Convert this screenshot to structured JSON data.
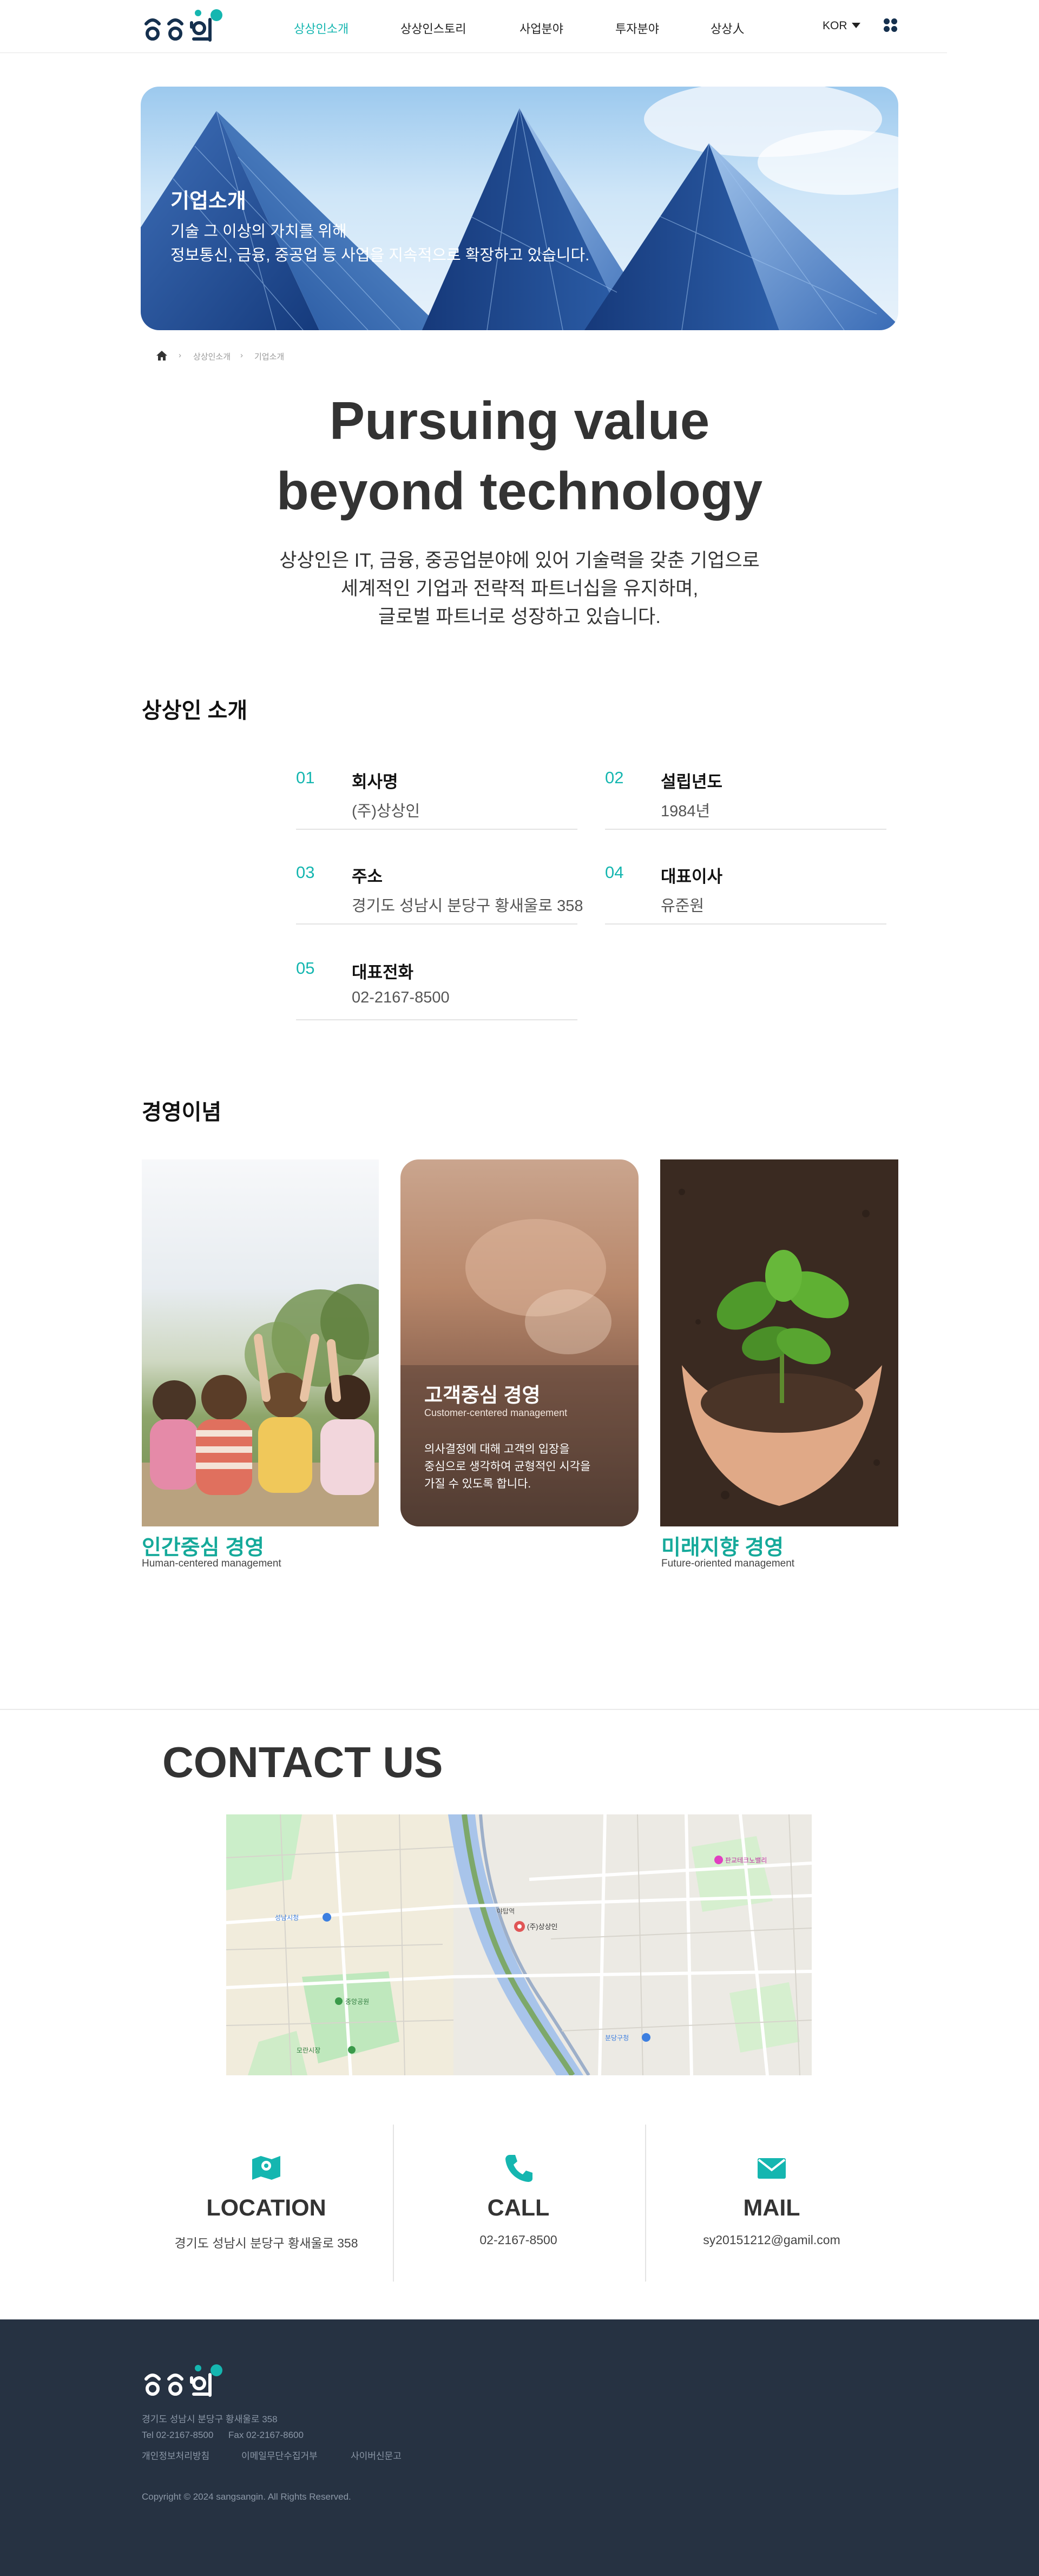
{
  "header": {
    "logo_alt": "상상인",
    "nav": [
      "상상인소개",
      "상상인스토리",
      "사업분야",
      "투자분야",
      "상상人"
    ],
    "active_index": 0,
    "lang": "KOR"
  },
  "hero": {
    "title": "기업소개",
    "subtitle_line1": "기술 그 이상의 가치를 위해",
    "subtitle_line2": "정보통신, 금융, 중공업 등 사업을 지속적으로 확장하고 있습니다."
  },
  "breadcrumb": {
    "home_icon": "home-icon",
    "items": [
      "상상인소개",
      "기업소개"
    ]
  },
  "headline": {
    "line1": "Pursuing value",
    "line2": "beyond technology"
  },
  "intro": {
    "line1": "상상인은 IT, 금융, 중공업분야에 있어 기술력을 갖춘 기업으로",
    "line2": "세계적인 기업과 전략적 파트너십을 유지하며,",
    "line3": "글로벌 파트너로 성장하고 있습니다."
  },
  "about": {
    "title": "상상인 소개",
    "items": [
      {
        "num": "01",
        "label": "회사명",
        "value": "(주)상상인"
      },
      {
        "num": "02",
        "label": "설립년도",
        "value": "1984년"
      },
      {
        "num": "03",
        "label": "주소",
        "value": "경기도 성남시 분당구 황새울로 358"
      },
      {
        "num": "04",
        "label": "대표이사",
        "value": "유준원"
      },
      {
        "num": "05",
        "label": "대표전화",
        "value": "02-2167-8500"
      }
    ]
  },
  "philosophy": {
    "title": "경영이념",
    "cards": [
      {
        "title": "인간중심 경영",
        "subtitle": "Human-centered management"
      },
      {
        "title": "고객중심 경영",
        "subtitle": "Customer-centered management",
        "desc_line1": "의사결정에 대해 고객의 입장을",
        "desc_line2": "중심으로 생각하여 균형적인 시각을",
        "desc_line3": "가질 수 있도록 합니다."
      },
      {
        "title": "미래지향 경영",
        "subtitle": "Future-oriented management"
      }
    ]
  },
  "contact": {
    "title": "CONTACT US",
    "map_labels": {
      "marker": "(주)상상인",
      "place1": "성남시청",
      "place2": "모란시장",
      "place3": "야탑역",
      "place4": "분당구청",
      "place5": "판교테크노밸리",
      "park": "중앙공원"
    },
    "items": [
      {
        "title": "LOCATION",
        "value": "경기도 성남시 분당구 황새울로 358",
        "icon": "map-icon"
      },
      {
        "title": "CALL",
        "value": "02-2167-8500",
        "icon": "phone-icon"
      },
      {
        "title": "MAIL",
        "value": "sy20151212@gamil.com",
        "icon": "mail-icon"
      }
    ]
  },
  "footer": {
    "address": "경기도 성남시 분당구 황새울로 358",
    "tel": "Tel 02-2167-8500",
    "fax": "Fax 02-2167-8600",
    "links": [
      "개인정보처리방침",
      "이메일무단수집거부",
      "사이버신문고"
    ],
    "copyright": "Copyright © 2024 sangsangin. All Rights Reserved."
  },
  "colors": {
    "accent": "#15b6b0",
    "accent_text": "#15a99a",
    "footer_bg": "#263242",
    "navy": "#15304e"
  }
}
